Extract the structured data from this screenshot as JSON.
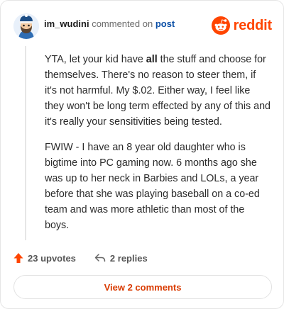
{
  "header": {
    "username": "im_wudini",
    "action": "commented on",
    "target": "post",
    "brand": "reddit"
  },
  "comment": {
    "p1_before": "YTA, let your kid have ",
    "p1_bold": "all",
    "p1_after": " the stuff and choose for themselves. There's no reason to steer them, if it's not harmful. My $.02. Either way, I feel like they won't be long term effected by any of this and it's really your sensitivities being tested.",
    "p2": "FWIW - I have an 8 year old daughter who is bigtime into PC gaming now. 6 months ago she was up to her neck in Barbies and LOLs, a year before that she was playing baseball on a co-ed team and was more athletic than most of the boys."
  },
  "footer": {
    "upvotes": "23 upvotes",
    "replies": "2 replies",
    "view_button": "View 2 comments"
  },
  "colors": {
    "brand": "#ff4500",
    "link": "#0b4fa6",
    "button_text": "#d93a00"
  },
  "icons": {
    "brand": "reddit-logo-icon",
    "upvote": "upvote-arrow-icon",
    "reply": "reply-arrow-icon",
    "avatar": "snoo-avatar-icon"
  }
}
